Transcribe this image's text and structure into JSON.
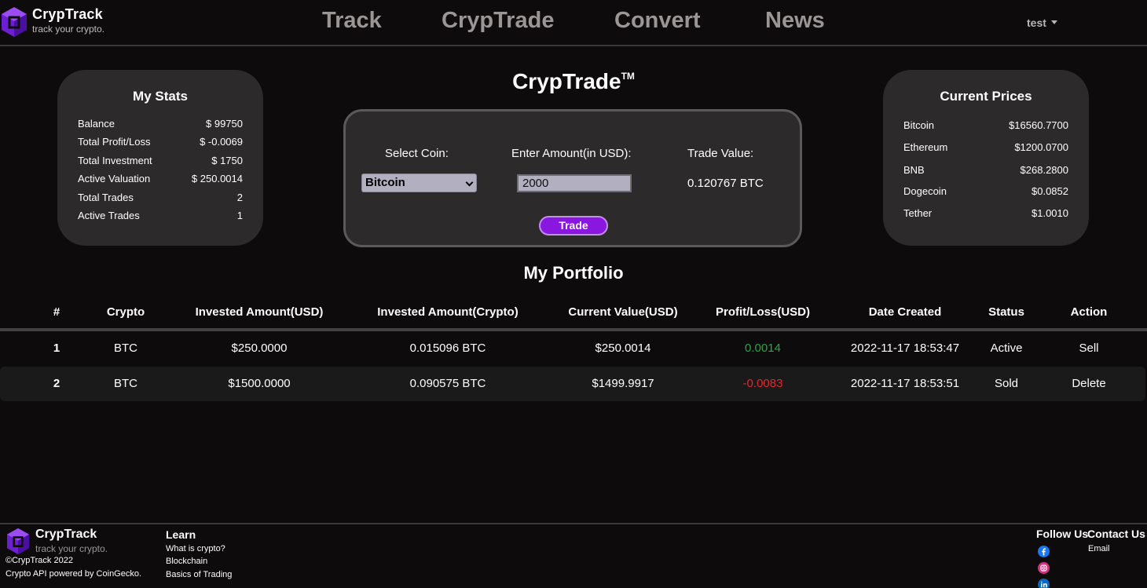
{
  "brand": {
    "name": "CrypTrack",
    "tagline": "track your crypto.",
    "accent": "#8a17e0"
  },
  "nav": {
    "items": [
      "Track",
      "CrypTrade",
      "Convert",
      "News"
    ],
    "user": "test"
  },
  "page": {
    "title": "CrypTrade",
    "trademark": "TM"
  },
  "stats": {
    "title": "My Stats",
    "rows": [
      {
        "label": "Balance",
        "value": "$ 99750"
      },
      {
        "label": "Total Profit/Loss",
        "value": "$ -0.0069"
      },
      {
        "label": "Total Investment",
        "value": "$ 1750"
      },
      {
        "label": "Active Valuation",
        "value": "$ 250.0014"
      },
      {
        "label": "Total Trades",
        "value": "2"
      },
      {
        "label": "Active Trades",
        "value": "1"
      }
    ]
  },
  "trade": {
    "select_label": "Select Coin:",
    "amount_label": "Enter Amount(in USD):",
    "value_label": "Trade Value:",
    "selected_coin": "Bitcoin",
    "amount": "2000",
    "trade_value": "0.120767 BTC",
    "button": "Trade"
  },
  "prices": {
    "title": "Current Prices",
    "rows": [
      {
        "coin": "Bitcoin",
        "price": "$16560.7700"
      },
      {
        "coin": "Ethereum",
        "price": "$1200.0700"
      },
      {
        "coin": "BNB",
        "price": "$268.2800"
      },
      {
        "coin": "Dogecoin",
        "price": "$0.0852"
      },
      {
        "coin": "Tether",
        "price": "$1.0010"
      }
    ]
  },
  "portfolio": {
    "title": "My Portfolio",
    "headers": [
      "#",
      "Crypto",
      "Invested Amount(USD)",
      "Invested Amount(Crypto)",
      "Current Value(USD)",
      "Profit/Loss(USD)",
      "Date Created",
      "Status",
      "Action"
    ],
    "rows": [
      {
        "num": "1",
        "crypto": "BTC",
        "invested_usd": "$250.0000",
        "invested_crypto": "0.015096 BTC",
        "current_value": "$250.0014",
        "profit_loss": "0.0014",
        "date": "2022-11-17 18:53:47",
        "status": "Active",
        "action": "Sell"
      },
      {
        "num": "2",
        "crypto": "BTC",
        "invested_usd": "$1500.0000",
        "invested_crypto": "0.090575 BTC",
        "current_value": "$1499.9917",
        "profit_loss": "-0.0083",
        "date": "2022-11-17 18:53:51",
        "status": "Sold",
        "action": "Delete"
      }
    ]
  },
  "footer": {
    "copyright": "©CrypTrack 2022",
    "api": "Crypto API powered by CoinGecko.",
    "learn_title": "Learn",
    "learn_links": [
      "What is crypto?",
      "Blockchain",
      "Basics of Trading"
    ],
    "follow_title": "Follow Us",
    "contact_title": "Contact Us",
    "contact_email": "Email",
    "social_icons": [
      "facebook-icon",
      "instagram-icon",
      "linkedin-icon"
    ]
  }
}
